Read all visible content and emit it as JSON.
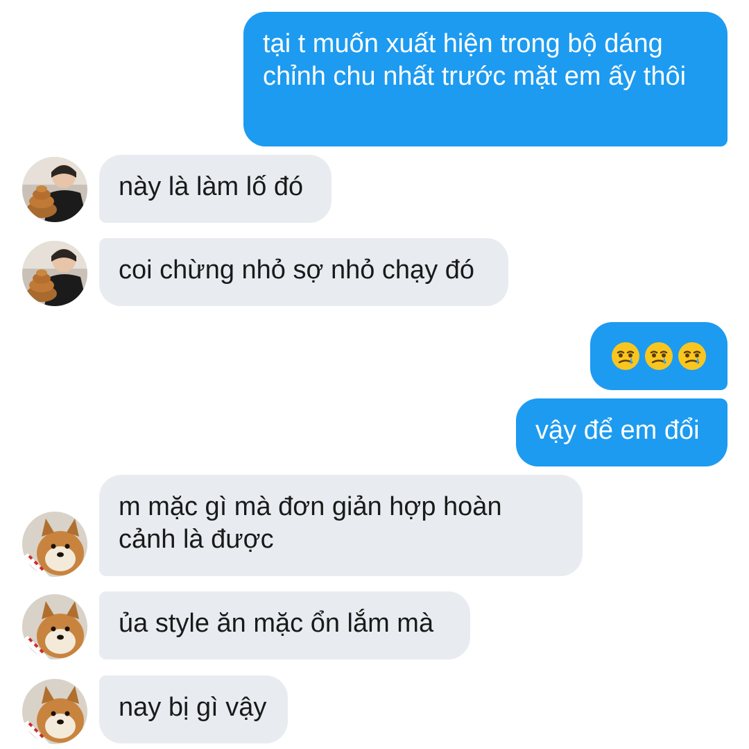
{
  "messages": [
    {
      "sender": "me",
      "text": "tại t muốn xuất hiện trong bộ dáng chỉnh chu nhất trước mặt em ấy thôi"
    },
    {
      "sender": "friend1",
      "text": "này là làm lố đó"
    },
    {
      "sender": "friend1",
      "text": "coi chừng nhỏ sợ nhỏ chạy đó"
    },
    {
      "sender": "me",
      "emoji": [
        "face-holding-back-tears-icon",
        "face-holding-back-tears-icon",
        "face-holding-back-tears-icon"
      ]
    },
    {
      "sender": "me",
      "text": "vậy để em đổi"
    },
    {
      "sender": "friend2",
      "text": "m mặc gì mà đơn giản hợp hoàn cảnh là được"
    },
    {
      "sender": "friend2",
      "text": "ủa style ăn mặc ổn lắm mà"
    },
    {
      "sender": "friend2",
      "text": "nay bị gì vậy"
    }
  ],
  "colors": {
    "outgoing_bubble": "#1d9bf0",
    "incoming_bubble": "#e8ecf0",
    "outgoing_text": "#ffffff",
    "incoming_text": "#1a1a1a"
  }
}
